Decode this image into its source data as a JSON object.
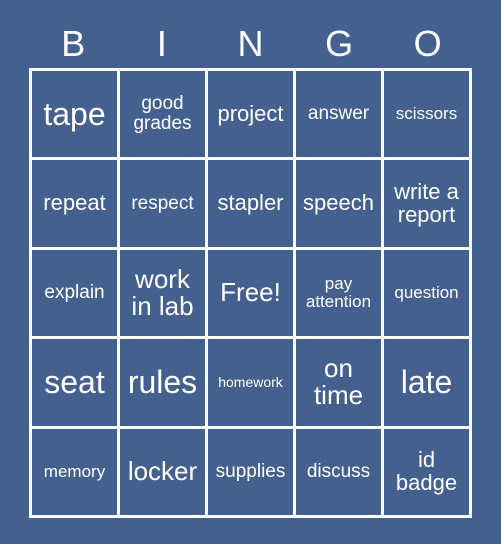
{
  "header": {
    "letters": [
      "B",
      "I",
      "N",
      "G",
      "O"
    ]
  },
  "colors": {
    "background": "#44608e",
    "cell_fill": "#44608e",
    "grid_line": "#ffffff",
    "text": "#ffffff"
  },
  "grid": {
    "columns": 5,
    "rows": 5,
    "cells": [
      {
        "text": "tape",
        "size": "fs-xxl"
      },
      {
        "text": "good\ngrades",
        "size": "fs-md"
      },
      {
        "text": "project",
        "size": "fs-lg"
      },
      {
        "text": "answer",
        "size": "fs-md"
      },
      {
        "text": "scissors",
        "size": "fs-sm"
      },
      {
        "text": "repeat",
        "size": "fs-lg"
      },
      {
        "text": "respect",
        "size": "fs-md"
      },
      {
        "text": "stapler",
        "size": "fs-lg"
      },
      {
        "text": "speech",
        "size": "fs-lg"
      },
      {
        "text": "write a\nreport",
        "size": "fs-lg"
      },
      {
        "text": "explain",
        "size": "fs-md"
      },
      {
        "text": "work\nin lab",
        "size": "fs-xl"
      },
      {
        "text": "Free!",
        "size": "fs-xl"
      },
      {
        "text": "pay\nattention",
        "size": "fs-sm"
      },
      {
        "text": "question",
        "size": "fs-sm"
      },
      {
        "text": "seat",
        "size": "fs-xxl"
      },
      {
        "text": "rules",
        "size": "fs-xxl"
      },
      {
        "text": "homework",
        "size": "fs-xs"
      },
      {
        "text": "on\ntime",
        "size": "fs-xl"
      },
      {
        "text": "late",
        "size": "fs-xxl"
      },
      {
        "text": "memory",
        "size": "fs-sm"
      },
      {
        "text": "locker",
        "size": "fs-xl"
      },
      {
        "text": "supplies",
        "size": "fs-md"
      },
      {
        "text": "discuss",
        "size": "fs-md"
      },
      {
        "text": "id\nbadge",
        "size": "fs-lg"
      }
    ]
  }
}
